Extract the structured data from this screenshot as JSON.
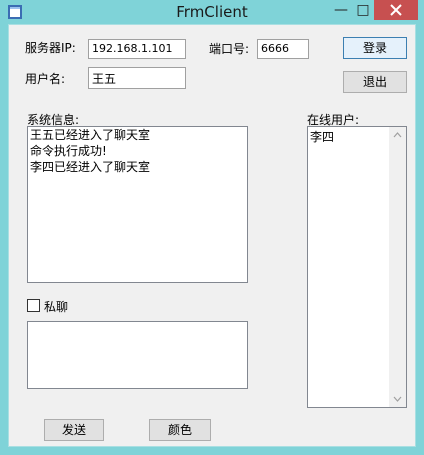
{
  "window": {
    "title": "FrmClient",
    "minimize": "—",
    "maximize": "□"
  },
  "form": {
    "server_ip_label": "服务器IP:",
    "server_ip_value": "192.168.1.101",
    "port_label": "端口号:",
    "port_value": "6666",
    "username_label": "用户名:",
    "username_value": "王五",
    "login_button": "登录",
    "exit_button": "退出",
    "system_info_label": "系统信息:",
    "system_messages": [
      "王五已经进入了聊天室",
      "命令执行成功!",
      "李四已经进入了聊天室"
    ],
    "online_users_label": "在线用户:",
    "online_users": [
      "李四"
    ],
    "private_chat_label": "私聊",
    "private_chat_checked": false,
    "message_input_value": "",
    "send_button": "发送",
    "color_button": "颜色"
  },
  "colors": {
    "window_frame": "#7fd3d8",
    "client_bg": "#f0f0f0",
    "close_button": "#c75050"
  }
}
